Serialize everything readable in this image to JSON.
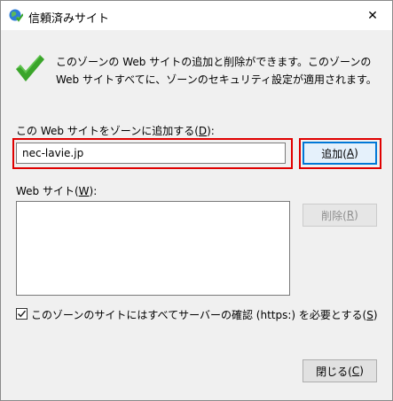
{
  "window": {
    "title": "信頼済みサイト",
    "close_glyph": "✕"
  },
  "description": "このゾーンの Web サイトの追加と削除ができます。このゾーンの Web サイトすべてに、ゾーンのセキュリティ設定が適用されます。",
  "add_section": {
    "label_prefix": "この Web サイトをゾーンに追加する(",
    "label_accel": "D",
    "label_suffix": "):",
    "input_value": "nec-lavie.jp",
    "add_prefix": "追加(",
    "add_accel": "A",
    "add_suffix": ")"
  },
  "sites_section": {
    "label_prefix": "Web サイト(",
    "label_accel": "W",
    "label_suffix": "):",
    "remove_prefix": "削除(",
    "remove_accel": "R",
    "remove_suffix": ")"
  },
  "https_option": {
    "label_prefix": "このゾーンのサイトにはすべてサーバーの確認 (https:) を必要とする(",
    "label_accel": "S",
    "label_suffix": ")",
    "checked": true
  },
  "footer": {
    "close_prefix": "閉じる(",
    "close_accel": "C",
    "close_suffix": ")"
  },
  "colors": {
    "highlight": "#e00000",
    "accent": "#0078d7",
    "check_green": "#3aa52a"
  }
}
